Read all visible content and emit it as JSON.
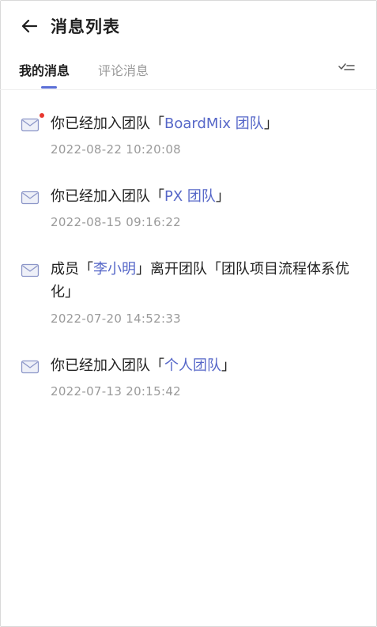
{
  "header": {
    "title": "消息列表",
    "back_icon": "arrow-left-icon"
  },
  "tabs": [
    {
      "label": "我的消息",
      "active": true
    },
    {
      "label": "评论消息",
      "active": false
    }
  ],
  "colors": {
    "accent": "#5b6fd6",
    "link": "#5667c8",
    "unread": "#e8382f",
    "muted": "#9a9a9a"
  },
  "messages": [
    {
      "unread": true,
      "prefix": "你已经加入团队「",
      "link": "BoardMix 团队",
      "suffix": "」",
      "time": "2022-08-22 10:20:08"
    },
    {
      "unread": false,
      "prefix": "你已经加入团队「",
      "link": "PX 团队",
      "suffix": "」",
      "time": "2022-08-15 09:16:22"
    },
    {
      "unread": false,
      "prefix": "成员「",
      "link": "李小明",
      "suffix": "」离开团队「团队项目流程体系优化」",
      "time": "2022-07-20 14:52:33"
    },
    {
      "unread": false,
      "prefix": "你已经加入团队「",
      "link": "个人团队",
      "suffix": "」",
      "time": "2022-07-13 20:15:42"
    }
  ]
}
